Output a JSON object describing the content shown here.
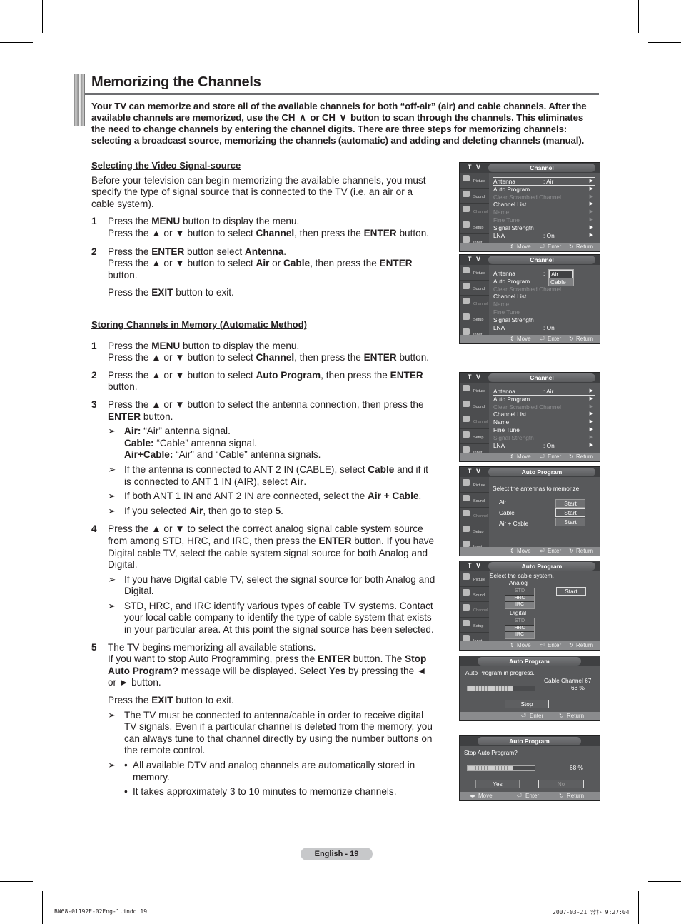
{
  "page": {
    "title": "Memorizing the Channels",
    "intro": {
      "part1": "Your TV can memorize and store all of the available channels for both “off-air” (air) and cable channels. After the available channels are memorized, use the CH ",
      "ch_up_icon": "⌃",
      "part2": " or CH ",
      "ch_down_icon": "⌄",
      "part3": " button to scan through the channels. This eliminates the need to change channels by entering the channel digits. There are three steps for memorizing channels: selecting a broadcast source, memorizing the channels (automatic) and adding and deleting channels (manual)."
    },
    "footer_page": "English - 19",
    "slug_left": "BN68-01192E-02Eng-1.indd   19",
    "slug_right": "2007-03-21   ｿﾀﾈﾄ 9:27:04"
  },
  "section1": {
    "heading": "Selecting the Video Signal-source",
    "body": "Before your television can begin memorizing the available channels, you must specify the type of signal source that is connected to the TV (i.e. an air or a cable system).",
    "steps": [
      {
        "num": "1",
        "l1a": "Press the ",
        "l1b": "MENU",
        "l1c": " button to display the menu.",
        "l2a": "Press the ▲ or ▼ button to select ",
        "l2b": "Channel",
        "l2c": ", then press the ",
        "l2d": "ENTER",
        "l2e": " button."
      },
      {
        "num": "2",
        "l1a": "Press the ",
        "l1b": "ENTER",
        "l1c": " button select ",
        "l1d": "Antenna",
        "l1e": ".",
        "l2a": "Press the ▲ or ▼ button to select ",
        "l2b": "Air",
        "l2c": " or ",
        "l2d": "Cable",
        "l2e": ", then press the ",
        "l2f": "ENTER",
        "l2g": " button.",
        "l3a": "Press the ",
        "l3b": "EXIT",
        "l3c": " button to exit."
      }
    ]
  },
  "section2": {
    "heading": "Storing Channels in Memory (Automatic Method)",
    "step1": {
      "num": "1",
      "l1a": "Press the ",
      "l1b": "MENU",
      "l1c": " button to display the menu.",
      "l2a": "Press the ▲ or ▼ button to select ",
      "l2b": "Channel",
      "l2c": ", then press the ",
      "l2d": "ENTER",
      "l2e": " button."
    },
    "step2": {
      "num": "2",
      "a": "Press the ▲ or ▼ button to select ",
      "b": "Auto Program",
      "c": ", then press the ",
      "d": "ENTER",
      "e": " button."
    },
    "step3": {
      "num": "3",
      "a": "Press the ▲ or ▼ button to select the antenna connection, then press the ",
      "b": "ENTER",
      "c": " button.",
      "notes": [
        {
          "air_b": "Air:",
          "air_t": " “Air” antenna signal.",
          "cable_b": "Cable:",
          "cable_t": " “Cable” antenna signal.",
          "ac_b": "Air+Cable:",
          "ac_t": " “Air” and “Cable” antenna signals."
        },
        {
          "a": "If the antenna is connected to ANT 2 IN (CABLE), select ",
          "b": "Cable",
          "c": " and if it is connected to ANT 1 IN (AIR), select ",
          "d": "Air",
          "e": "."
        },
        {
          "a": "If both ANT 1 IN and ANT 2 IN are connected, select the ",
          "b": "Air + Cable",
          "c": "."
        },
        {
          "a": "If you selected ",
          "b": "Air",
          "c": ", then go to step ",
          "d": "5",
          "e": "."
        }
      ]
    },
    "step4": {
      "num": "4",
      "a": "Press the ▲ or ▼ to select the correct analog signal cable system source from among STD, HRC, and IRC, then press the ",
      "b": "ENTER",
      "c": " button. If you have Digital cable TV, select the cable system signal source for both Analog and Digital.",
      "notes": [
        "If you have Digital cable TV, select the signal source for both Analog and Digital.",
        "STD, HRC, and IRC identify various types of cable TV systems. Contact your local cable company to identify the type of cable system that exists in your particular area. At this point the signal source has been selected."
      ]
    },
    "step5": {
      "num": "5",
      "l1": "The TV begins memorizing all available stations.",
      "a": "If you want to stop Auto Programming, press the ",
      "b": "ENTER",
      "c": " button. The ",
      "d": "Stop Auto Program?",
      "e": " message will be displayed. Select ",
      "f": "Yes",
      "g": " by pressing the ◄ or ► button.",
      "exit_a": "Press the ",
      "exit_b": "EXIT",
      "exit_c": " button to exit.",
      "note1": "The TV must be connected to antenna/cable in order to receive digital TV signals. Even if a particular channel is deleted from the memory, you can always tune to that channel directly by using the number buttons on the remote control.",
      "bullets": [
        "All available DTV and analog channels are automatically stored in memory.",
        "It takes approximately 3 to 10 minutes to memorize channels."
      ]
    },
    "note_arrow": "➢",
    "bullet": "•"
  },
  "osd_common": {
    "tv_label": "T V",
    "sidebar": [
      "Picture",
      "Sound",
      "Channel",
      "Setup",
      "Input"
    ],
    "move": "Move",
    "enter": "Enter",
    "return": "Return",
    "move_icon": "⇕",
    "move_lr_icon": "◂▸",
    "enter_icon": "⏎",
    "return_icon": "↻",
    "submenu_arrow": "▶"
  },
  "osd1": {
    "title": "Channel",
    "rows": [
      {
        "label": "Antenna",
        "value": ": Air",
        "dim": false,
        "sel": true
      },
      {
        "label": "Auto Program",
        "value": "",
        "dim": false,
        "sel": false
      },
      {
        "label": "Clear Scrambled Channel",
        "value": "",
        "dim": true,
        "sel": false
      },
      {
        "label": "Channel List",
        "value": "",
        "dim": false,
        "sel": false
      },
      {
        "label": "Name",
        "value": "",
        "dim": true,
        "sel": false
      },
      {
        "label": "Fine Tune",
        "value": "",
        "dim": true,
        "sel": false
      },
      {
        "label": "Signal Strength",
        "value": "",
        "dim": false,
        "sel": false
      },
      {
        "label": "LNA",
        "value": ": On",
        "dim": false,
        "sel": false
      }
    ]
  },
  "osd2": {
    "title": "Channel",
    "rows": [
      "Antenna",
      "Auto Program",
      "Clear Scrambled Channel",
      "Channel List",
      "Name",
      "Fine Tune",
      "Signal Strength",
      "LNA"
    ],
    "antenna_colon": ":",
    "lna_value": ": On",
    "dropdown": [
      "Air",
      "Cable"
    ]
  },
  "osd3": {
    "title": "Channel",
    "rows": [
      {
        "label": "Antenna",
        "value": ": Air"
      },
      {
        "label": "Auto Program",
        "value": ""
      },
      {
        "label": "Clear Scrambled Channel",
        "value": ""
      },
      {
        "label": "Channel List",
        "value": ""
      },
      {
        "label": "Name",
        "value": ""
      },
      {
        "label": "Fine Tune",
        "value": ""
      },
      {
        "label": "Signal Strength",
        "value": ""
      },
      {
        "label": "LNA",
        "value": ": On"
      }
    ]
  },
  "osd4": {
    "title": "Auto Program",
    "prompt": "Select the antennas to memorize.",
    "options": [
      "Air",
      "Cable",
      "Air + Cable"
    ],
    "start": "Start"
  },
  "osd5": {
    "title": "Auto Program",
    "prompt": "Select the cable system.",
    "analog": "Analog",
    "digital": "Digital",
    "systems": [
      "STD",
      "HRC",
      "IRC"
    ],
    "start": "Start"
  },
  "osd6": {
    "title": "Auto Program",
    "status": "Auto Program in progress.",
    "channel": "Cable Channel 67",
    "percent": "68 %",
    "progress": 0.68,
    "stop": "Stop"
  },
  "osd7": {
    "title": "Auto Program",
    "prompt": "Stop Auto Program?",
    "percent": "68 %",
    "progress": 0.68,
    "yes": "Yes",
    "no": "No"
  }
}
